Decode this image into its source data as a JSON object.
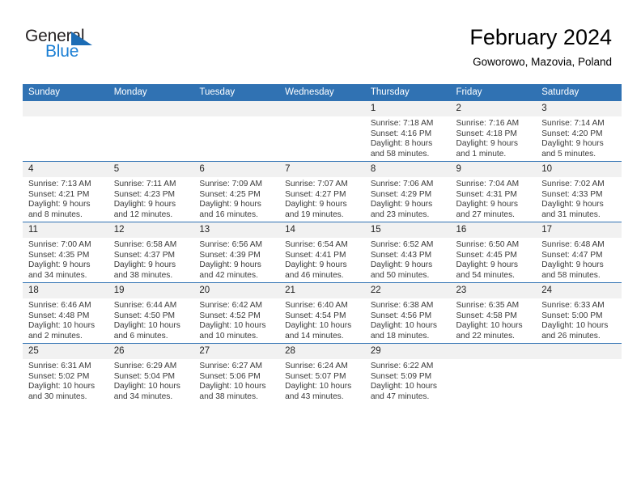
{
  "brand": {
    "name_part1": "General",
    "name_part2": "Blue",
    "logo_icon": "blue-triangle-logo"
  },
  "header": {
    "title": "February 2024",
    "subtitle": "Goworowo, Mazovia, Poland"
  },
  "colors": {
    "header_blue": "#3072b3",
    "brand_blue": "#1b7fd4",
    "daynum_background": "#f1f1f1",
    "text": "#3a3a3a"
  },
  "weekdays": [
    "Sunday",
    "Monday",
    "Tuesday",
    "Wednesday",
    "Thursday",
    "Friday",
    "Saturday"
  ],
  "weeks": [
    [
      {
        "day": "",
        "empty": true
      },
      {
        "day": "",
        "empty": true
      },
      {
        "day": "",
        "empty": true
      },
      {
        "day": "",
        "empty": true
      },
      {
        "day": "1",
        "sunrise": "Sunrise: 7:18 AM",
        "sunset": "Sunset: 4:16 PM",
        "daylight_line1": "Daylight: 8 hours",
        "daylight_line2": "and 58 minutes."
      },
      {
        "day": "2",
        "sunrise": "Sunrise: 7:16 AM",
        "sunset": "Sunset: 4:18 PM",
        "daylight_line1": "Daylight: 9 hours",
        "daylight_line2": "and 1 minute."
      },
      {
        "day": "3",
        "sunrise": "Sunrise: 7:14 AM",
        "sunset": "Sunset: 4:20 PM",
        "daylight_line1": "Daylight: 9 hours",
        "daylight_line2": "and 5 minutes."
      }
    ],
    [
      {
        "day": "4",
        "sunrise": "Sunrise: 7:13 AM",
        "sunset": "Sunset: 4:21 PM",
        "daylight_line1": "Daylight: 9 hours",
        "daylight_line2": "and 8 minutes."
      },
      {
        "day": "5",
        "sunrise": "Sunrise: 7:11 AM",
        "sunset": "Sunset: 4:23 PM",
        "daylight_line1": "Daylight: 9 hours",
        "daylight_line2": "and 12 minutes."
      },
      {
        "day": "6",
        "sunrise": "Sunrise: 7:09 AM",
        "sunset": "Sunset: 4:25 PM",
        "daylight_line1": "Daylight: 9 hours",
        "daylight_line2": "and 16 minutes."
      },
      {
        "day": "7",
        "sunrise": "Sunrise: 7:07 AM",
        "sunset": "Sunset: 4:27 PM",
        "daylight_line1": "Daylight: 9 hours",
        "daylight_line2": "and 19 minutes."
      },
      {
        "day": "8",
        "sunrise": "Sunrise: 7:06 AM",
        "sunset": "Sunset: 4:29 PM",
        "daylight_line1": "Daylight: 9 hours",
        "daylight_line2": "and 23 minutes."
      },
      {
        "day": "9",
        "sunrise": "Sunrise: 7:04 AM",
        "sunset": "Sunset: 4:31 PM",
        "daylight_line1": "Daylight: 9 hours",
        "daylight_line2": "and 27 minutes."
      },
      {
        "day": "10",
        "sunrise": "Sunrise: 7:02 AM",
        "sunset": "Sunset: 4:33 PM",
        "daylight_line1": "Daylight: 9 hours",
        "daylight_line2": "and 31 minutes."
      }
    ],
    [
      {
        "day": "11",
        "sunrise": "Sunrise: 7:00 AM",
        "sunset": "Sunset: 4:35 PM",
        "daylight_line1": "Daylight: 9 hours",
        "daylight_line2": "and 34 minutes."
      },
      {
        "day": "12",
        "sunrise": "Sunrise: 6:58 AM",
        "sunset": "Sunset: 4:37 PM",
        "daylight_line1": "Daylight: 9 hours",
        "daylight_line2": "and 38 minutes."
      },
      {
        "day": "13",
        "sunrise": "Sunrise: 6:56 AM",
        "sunset": "Sunset: 4:39 PM",
        "daylight_line1": "Daylight: 9 hours",
        "daylight_line2": "and 42 minutes."
      },
      {
        "day": "14",
        "sunrise": "Sunrise: 6:54 AM",
        "sunset": "Sunset: 4:41 PM",
        "daylight_line1": "Daylight: 9 hours",
        "daylight_line2": "and 46 minutes."
      },
      {
        "day": "15",
        "sunrise": "Sunrise: 6:52 AM",
        "sunset": "Sunset: 4:43 PM",
        "daylight_line1": "Daylight: 9 hours",
        "daylight_line2": "and 50 minutes."
      },
      {
        "day": "16",
        "sunrise": "Sunrise: 6:50 AM",
        "sunset": "Sunset: 4:45 PM",
        "daylight_line1": "Daylight: 9 hours",
        "daylight_line2": "and 54 minutes."
      },
      {
        "day": "17",
        "sunrise": "Sunrise: 6:48 AM",
        "sunset": "Sunset: 4:47 PM",
        "daylight_line1": "Daylight: 9 hours",
        "daylight_line2": "and 58 minutes."
      }
    ],
    [
      {
        "day": "18",
        "sunrise": "Sunrise: 6:46 AM",
        "sunset": "Sunset: 4:48 PM",
        "daylight_line1": "Daylight: 10 hours",
        "daylight_line2": "and 2 minutes."
      },
      {
        "day": "19",
        "sunrise": "Sunrise: 6:44 AM",
        "sunset": "Sunset: 4:50 PM",
        "daylight_line1": "Daylight: 10 hours",
        "daylight_line2": "and 6 minutes."
      },
      {
        "day": "20",
        "sunrise": "Sunrise: 6:42 AM",
        "sunset": "Sunset: 4:52 PM",
        "daylight_line1": "Daylight: 10 hours",
        "daylight_line2": "and 10 minutes."
      },
      {
        "day": "21",
        "sunrise": "Sunrise: 6:40 AM",
        "sunset": "Sunset: 4:54 PM",
        "daylight_line1": "Daylight: 10 hours",
        "daylight_line2": "and 14 minutes."
      },
      {
        "day": "22",
        "sunrise": "Sunrise: 6:38 AM",
        "sunset": "Sunset: 4:56 PM",
        "daylight_line1": "Daylight: 10 hours",
        "daylight_line2": "and 18 minutes."
      },
      {
        "day": "23",
        "sunrise": "Sunrise: 6:35 AM",
        "sunset": "Sunset: 4:58 PM",
        "daylight_line1": "Daylight: 10 hours",
        "daylight_line2": "and 22 minutes."
      },
      {
        "day": "24",
        "sunrise": "Sunrise: 6:33 AM",
        "sunset": "Sunset: 5:00 PM",
        "daylight_line1": "Daylight: 10 hours",
        "daylight_line2": "and 26 minutes."
      }
    ],
    [
      {
        "day": "25",
        "sunrise": "Sunrise: 6:31 AM",
        "sunset": "Sunset: 5:02 PM",
        "daylight_line1": "Daylight: 10 hours",
        "daylight_line2": "and 30 minutes."
      },
      {
        "day": "26",
        "sunrise": "Sunrise: 6:29 AM",
        "sunset": "Sunset: 5:04 PM",
        "daylight_line1": "Daylight: 10 hours",
        "daylight_line2": "and 34 minutes."
      },
      {
        "day": "27",
        "sunrise": "Sunrise: 6:27 AM",
        "sunset": "Sunset: 5:06 PM",
        "daylight_line1": "Daylight: 10 hours",
        "daylight_line2": "and 38 minutes."
      },
      {
        "day": "28",
        "sunrise": "Sunrise: 6:24 AM",
        "sunset": "Sunset: 5:07 PM",
        "daylight_line1": "Daylight: 10 hours",
        "daylight_line2": "and 43 minutes."
      },
      {
        "day": "29",
        "sunrise": "Sunrise: 6:22 AM",
        "sunset": "Sunset: 5:09 PM",
        "daylight_line1": "Daylight: 10 hours",
        "daylight_line2": "and 47 minutes."
      },
      {
        "day": "",
        "empty": true
      },
      {
        "day": "",
        "empty": true
      }
    ]
  ]
}
